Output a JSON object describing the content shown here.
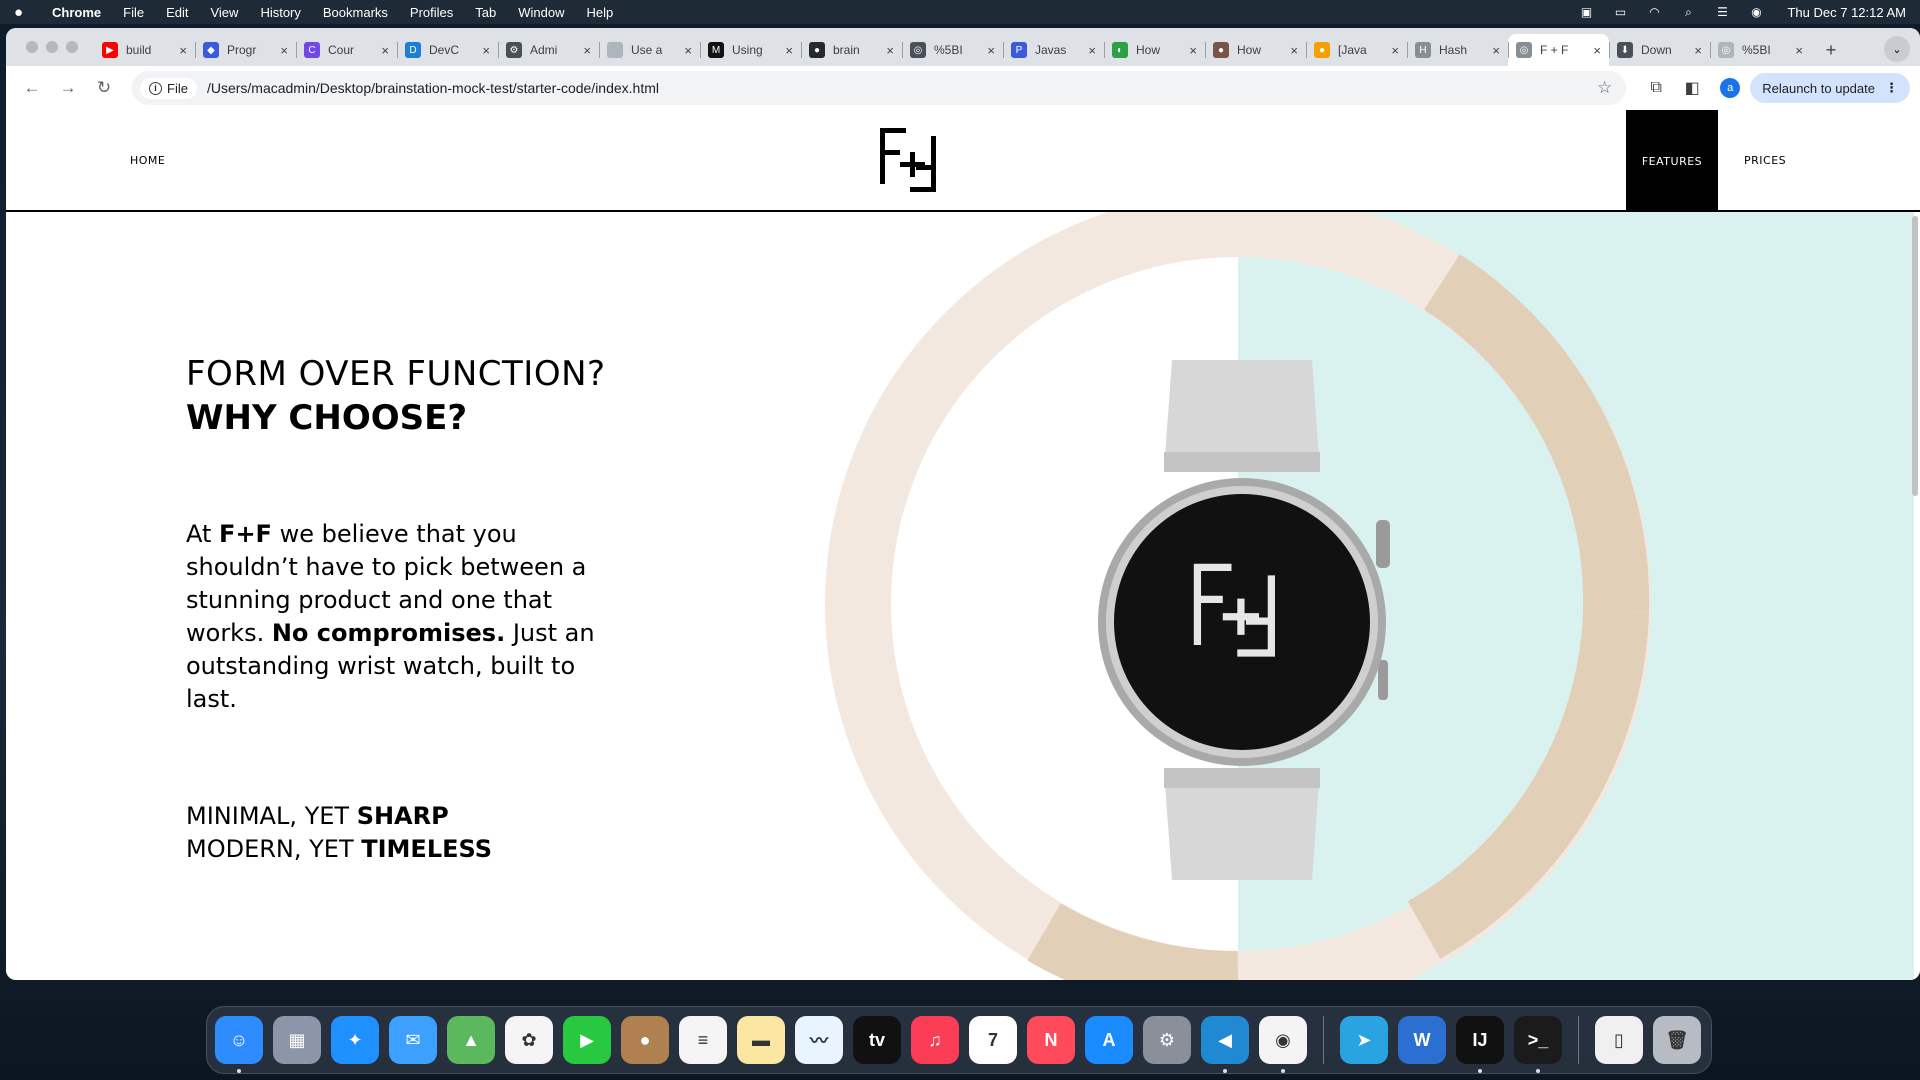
{
  "menubar": {
    "app": "Chrome",
    "items": [
      "File",
      "Edit",
      "View",
      "History",
      "Bookmarks",
      "Profiles",
      "Tab",
      "Window",
      "Help"
    ],
    "clock": "Thu Dec 7  12:12 AM"
  },
  "tabs": [
    {
      "title": "build",
      "color": "#ff0000",
      "glyph": "▶"
    },
    {
      "title": "Progr",
      "color": "#3b5bdb",
      "glyph": "◆"
    },
    {
      "title": "Cour",
      "color": "#7048e8",
      "glyph": "C"
    },
    {
      "title": "DevC",
      "color": "#1c7ed6",
      "glyph": "D"
    },
    {
      "title": "Admi",
      "color": "#495057",
      "glyph": "⚙"
    },
    {
      "title": "Use a",
      "color": "#adb5bd",
      "glyph": ""
    },
    {
      "title": "Using",
      "color": "#111111",
      "glyph": "M"
    },
    {
      "title": "brain",
      "color": "#24292f",
      "glyph": "●"
    },
    {
      "title": "%5BI",
      "color": "#495057",
      "glyph": "◎"
    },
    {
      "title": "Javas",
      "color": "#3b5bdb",
      "glyph": "P"
    },
    {
      "title": "How",
      "color": "#2f9e44",
      "glyph": "◐"
    },
    {
      "title": "How",
      "color": "#795548",
      "glyph": "●"
    },
    {
      "title": "[Java",
      "color": "#f59f00",
      "glyph": "●"
    },
    {
      "title": "Hash",
      "color": "#868e96",
      "glyph": "H"
    },
    {
      "title": "F + F",
      "color": "#868e96",
      "glyph": "◎",
      "active": true
    },
    {
      "title": "Down",
      "color": "#495057",
      "glyph": "⬇"
    },
    {
      "title": "%5BI",
      "color": "#adb5bd",
      "glyph": "◎"
    }
  ],
  "toolbar": {
    "chip_label": "File",
    "url": "/Users/macadmin/Desktop/brainstation-mock-test/starter-code/index.html",
    "profile_initial": "a",
    "relaunch_label": "Relaunch to update"
  },
  "site": {
    "nav_home": "HOME",
    "nav_features": "FEATURES",
    "nav_prices": "PRICES",
    "heading_line1": "FORM OVER FUNCTION?",
    "heading_line2": "WHY CHOOSE?",
    "body_p1": "At ",
    "body_brand": "F+F",
    "body_p2": " we believe that you shouldn’t have to pick between a stunning product and one that works. ",
    "body_bold": "No compromises.",
    "body_p3": " Just an outstanding wrist watch, built to last.",
    "tag1_regular": "MINIMAL, YET ",
    "tag1_bold": "SHARP",
    "tag2_regular": "MODERN, YET ",
    "tag2_bold": "TIMELESS",
    "colors": {
      "teal": "#d9f1ef",
      "ring_light": "#f2e8df",
      "ring_dark": "#e2cfb8",
      "accent": "#000000"
    }
  },
  "dock": [
    {
      "name": "finder",
      "color": "#2f8cff",
      "glyph": "☺",
      "running": true
    },
    {
      "name": "launchpad",
      "color": "#8c96a8",
      "glyph": "▦",
      "running": false
    },
    {
      "name": "safari",
      "color": "#1e90ff",
      "glyph": "✦",
      "running": false
    },
    {
      "name": "mail",
      "color": "#3da0ff",
      "glyph": "✉",
      "running": false
    },
    {
      "name": "maps",
      "color": "#5cb85c",
      "glyph": "▲",
      "running": false
    },
    {
      "name": "photos",
      "color": "#f5f5f5",
      "glyph": "✿",
      "running": false
    },
    {
      "name": "facetime",
      "color": "#28c840",
      "glyph": "▶",
      "running": false
    },
    {
      "name": "contacts",
      "color": "#b08050",
      "glyph": "●",
      "running": false
    },
    {
      "name": "reminders",
      "color": "#f5f5f5",
      "glyph": "≡",
      "running": false
    },
    {
      "name": "notes",
      "color": "#fbe7a1",
      "glyph": "▬",
      "running": false
    },
    {
      "name": "freeform",
      "color": "#e8f4ff",
      "glyph": "〰",
      "running": false
    },
    {
      "name": "tv",
      "color": "#111111",
      "glyph": "tv",
      "running": false
    },
    {
      "name": "music",
      "color": "#fa3c55",
      "glyph": "♫",
      "running": false
    },
    {
      "name": "calendar",
      "color": "#ffffff",
      "glyph": "7",
      "running": false
    },
    {
      "name": "news",
      "color": "#ff4a5c",
      "glyph": "N",
      "running": false
    },
    {
      "name": "app-store",
      "color": "#1a8cff",
      "glyph": "A",
      "running": false
    },
    {
      "name": "system-settings",
      "color": "#8a8f99",
      "glyph": "⚙",
      "running": false
    },
    {
      "name": "vscode",
      "color": "#1f8ad2",
      "glyph": "◀",
      "running": true
    },
    {
      "name": "chrome",
      "color": "#f4f4f4",
      "glyph": "◉",
      "running": true
    },
    {
      "name": "telegram",
      "color": "#2aa3e3",
      "glyph": "➤",
      "running": false
    },
    {
      "name": "word",
      "color": "#2b6fd1",
      "glyph": "W",
      "running": false
    },
    {
      "name": "intellij",
      "color": "#111111",
      "glyph": "IJ",
      "running": true
    },
    {
      "name": "terminal",
      "color": "#1b1b1b",
      "glyph": ">_",
      "running": true
    },
    {
      "name": "document",
      "color": "#f0f0f0",
      "glyph": "▯",
      "running": false
    },
    {
      "name": "trash",
      "color": "#b7bcc4",
      "glyph": "🗑",
      "running": false
    }
  ]
}
